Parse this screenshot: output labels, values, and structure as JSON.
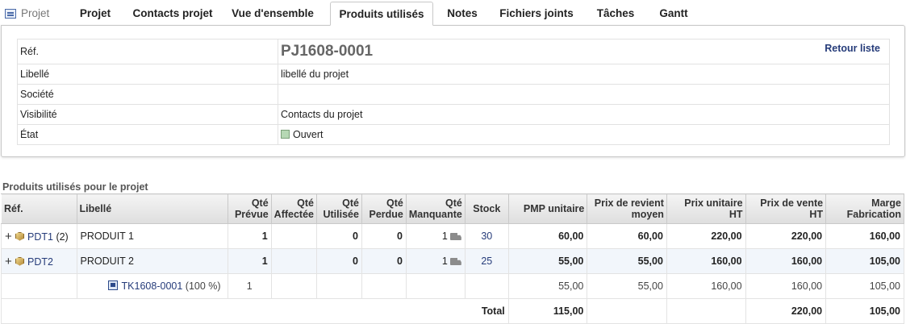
{
  "tabs": [
    {
      "label": "Projet",
      "kind": "project"
    },
    {
      "label": "Projet"
    },
    {
      "label": "Contacts projet"
    },
    {
      "label": "Vue d'ensemble"
    },
    {
      "label": "Produits utilisés",
      "active": true
    },
    {
      "label": "Notes"
    },
    {
      "label": "Fichiers joints"
    },
    {
      "label": "Tâches"
    },
    {
      "label": "Gantt"
    }
  ],
  "project": {
    "ref_label": "Réf.",
    "ref_value": "PJ1608-0001",
    "back_link": "Retour liste",
    "libelle_label": "Libellé",
    "libelle_value": "libellé du projet",
    "societe_label": "Société",
    "societe_value": "",
    "visibilite_label": "Visibilité",
    "visibilite_value": "Contacts du projet",
    "etat_label": "État",
    "etat_value": "Ouvert",
    "etat_color": "#b6d8b4"
  },
  "section_title": "Produits utilisés pour le projet",
  "table": {
    "headers": {
      "ref": "Réf.",
      "libelle": "Libellé",
      "qte_prevue_1": "Qté",
      "qte_prevue_2": "Prévue",
      "qte_affectee_1": "Qté",
      "qte_affectee_2": "Affectée",
      "qte_utilisee_1": "Qté",
      "qte_utilisee_2": "Utilisée",
      "qte_perdue_1": "Qté",
      "qte_perdue_2": "Perdue",
      "qte_manquante_1": "Qté",
      "qte_manquante_2": "Manquante",
      "stock": "Stock",
      "pmp": "PMP unitaire",
      "prix_revient_1": "Prix de revient",
      "prix_revient_2": "moyen",
      "prix_unitaire_1": "Prix unitaire",
      "prix_unitaire_2": "HT",
      "prix_vente_1": "Prix de vente",
      "prix_vente_2": "HT",
      "marge_1": "Marge",
      "marge_2": "Fabrication"
    },
    "rows": [
      {
        "ref": "PDT1",
        "ref_suffix": "(2)",
        "libelle": "PRODUIT 1",
        "prevue": "1",
        "affectee": "",
        "utilisee": "0",
        "perdue": "0",
        "manquante": "1",
        "stock": "30",
        "pmp": "60,00",
        "prix_revient": "60,00",
        "prix_unitaire": "220,00",
        "prix_vente": "220,00",
        "marge": "160,00"
      },
      {
        "ref": "PDT2",
        "ref_suffix": "",
        "libelle": "PRODUIT 2",
        "prevue": "1",
        "affectee": "",
        "utilisee": "0",
        "perdue": "0",
        "manquante": "1",
        "stock": "25",
        "pmp": "55,00",
        "prix_revient": "55,00",
        "prix_unitaire": "160,00",
        "prix_vente": "160,00",
        "marge": "105,00"
      }
    ],
    "subrow": {
      "task_ref": "TK1608-0001",
      "task_pct": "(100 %)",
      "prevue": "1",
      "pmp": "55,00",
      "prix_revient": "55,00",
      "prix_unitaire": "160,00",
      "prix_vente": "160,00",
      "marge": "105,00"
    },
    "total": {
      "label": "Total",
      "pmp": "115,00",
      "prix_vente": "220,00",
      "marge": "105,00"
    }
  }
}
